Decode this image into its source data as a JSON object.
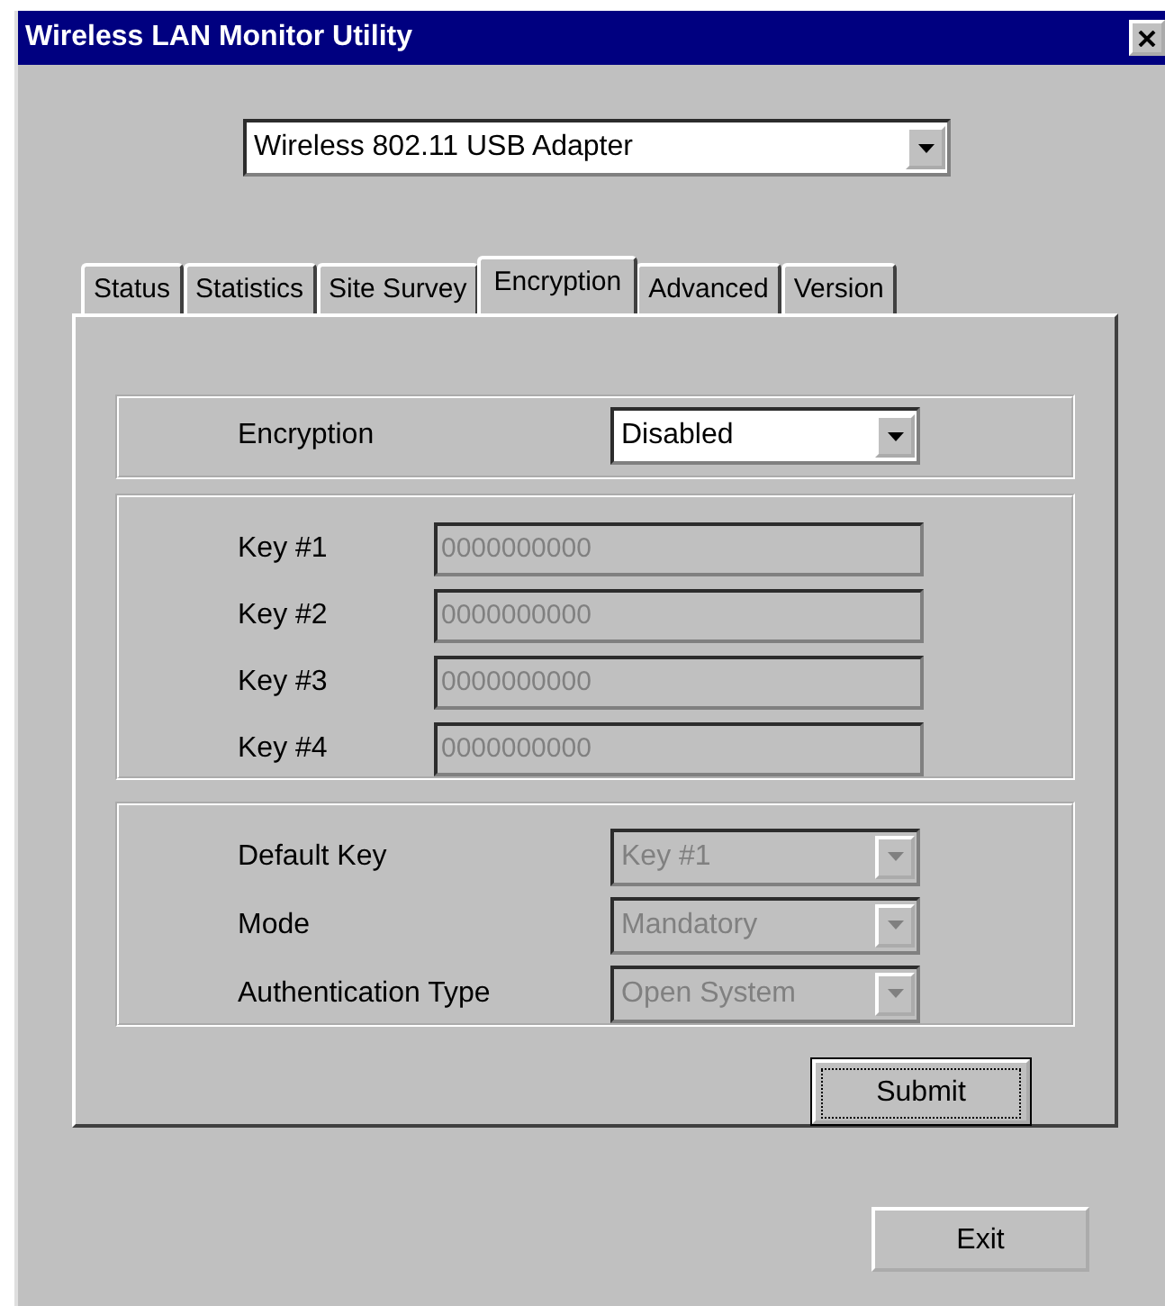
{
  "window": {
    "title": "Wireless LAN Monitor Utility"
  },
  "adapter": {
    "value": "Wireless 802.11 USB Adapter",
    "disabled": false
  },
  "tabs": [
    {
      "label": "Status",
      "selected": false
    },
    {
      "label": "Statistics",
      "selected": false
    },
    {
      "label": "Site Survey",
      "selected": false
    },
    {
      "label": "Encryption",
      "selected": true
    },
    {
      "label": "Advanced",
      "selected": false
    },
    {
      "label": "Version",
      "selected": false
    }
  ],
  "encryption": {
    "label": "Encryption",
    "value": "Disabled",
    "disabled": false
  },
  "keys": [
    {
      "label": "Key #1",
      "value": "0000000000",
      "disabled": true
    },
    {
      "label": "Key #2",
      "value": "0000000000",
      "disabled": true
    },
    {
      "label": "Key #3",
      "value": "0000000000",
      "disabled": true
    },
    {
      "label": "Key #4",
      "value": "0000000000",
      "disabled": true
    }
  ],
  "options": [
    {
      "label": "Default Key",
      "value": "Key #1",
      "disabled": true
    },
    {
      "label": "Mode",
      "value": "Mandatory",
      "disabled": true
    },
    {
      "label": "Authentication Type",
      "value": "Open System",
      "disabled": true
    }
  ],
  "submit": {
    "label": "Submit",
    "focused": true
  },
  "exit": {
    "label": "Exit",
    "focused": false
  }
}
